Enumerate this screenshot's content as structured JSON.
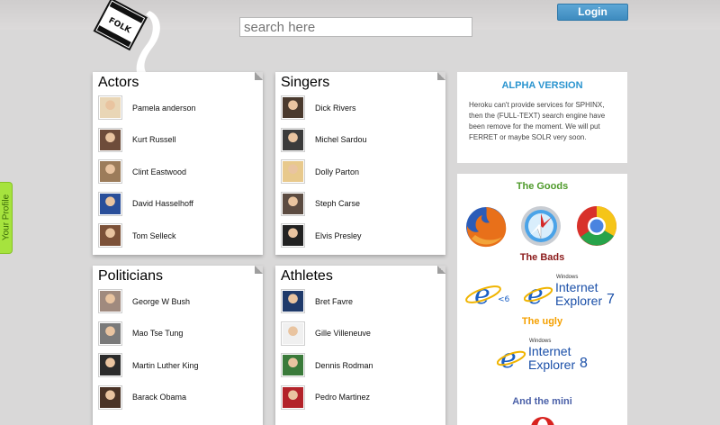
{
  "search": {
    "placeholder": "search here"
  },
  "header": {
    "login_label": "Login"
  },
  "profile_tab": {
    "label": "Your Profile"
  },
  "categories": [
    {
      "title": "Actors",
      "people": [
        {
          "name": "Pamela anderson",
          "color": "#e9d6b6"
        },
        {
          "name": "Kurt Russell",
          "color": "#6e4c3a"
        },
        {
          "name": "Clint Eastwood",
          "color": "#9c7c5a"
        },
        {
          "name": "David Hasselhoff",
          "color": "#2a4f9a"
        },
        {
          "name": "Tom Selleck",
          "color": "#7c5138"
        }
      ]
    },
    {
      "title": "Singers",
      "people": [
        {
          "name": "Dick Rivers",
          "color": "#4a3a2e"
        },
        {
          "name": "Michel Sardou",
          "color": "#3b3b3b"
        },
        {
          "name": "Dolly Parton",
          "color": "#e8c98c"
        },
        {
          "name": "Steph Carse",
          "color": "#5b4b41"
        },
        {
          "name": "Elvis Presley",
          "color": "#222222"
        }
      ]
    },
    {
      "title": "Politicians",
      "people": [
        {
          "name": "George W Bush",
          "color": "#a08a7e"
        },
        {
          "name": "Mao Tse Tung",
          "color": "#7a7a7a"
        },
        {
          "name": "Martin Luther King",
          "color": "#2b2b2b"
        },
        {
          "name": "Barack Obama",
          "color": "#4a3326"
        }
      ]
    },
    {
      "title": "Athletes",
      "people": [
        {
          "name": "Bret Favre",
          "color": "#1f3a6a"
        },
        {
          "name": "Gille Villeneuve",
          "color": "#f0f0f0"
        },
        {
          "name": "Dennis Rodman",
          "color": "#3a7a3a"
        },
        {
          "name": "Pedro Martinez",
          "color": "#b3232a"
        }
      ]
    }
  ],
  "alpha": {
    "title": "ALPHA VERSION",
    "text": "Heroku can't provide services for SPHINX, then the (FULL-TEXT) search engine have been remove for the moment. We will put FERRET or maybe SOLR very soon."
  },
  "browsers": {
    "goods_title": "The Goods",
    "bads_title": "The Bads",
    "ugly_title": "The ugly",
    "mini_title": "And the mini",
    "ie7_small": "Windows",
    "ie7_big1": "Internet",
    "ie7_big2": "Explorer",
    "ie7_ver": "7",
    "ie8_small": "Windows",
    "ie8_big1": "Internet",
    "ie8_big2": "Explorer",
    "ie8_ver": "8",
    "ie6_label": "<6"
  },
  "colors": {
    "accent_blue": "#2a94cf",
    "goods_green": "#4e9a2a",
    "bads_red": "#8b1a1a",
    "ugly_orange": "#f5a000",
    "mini_blue": "#4a60a8"
  }
}
